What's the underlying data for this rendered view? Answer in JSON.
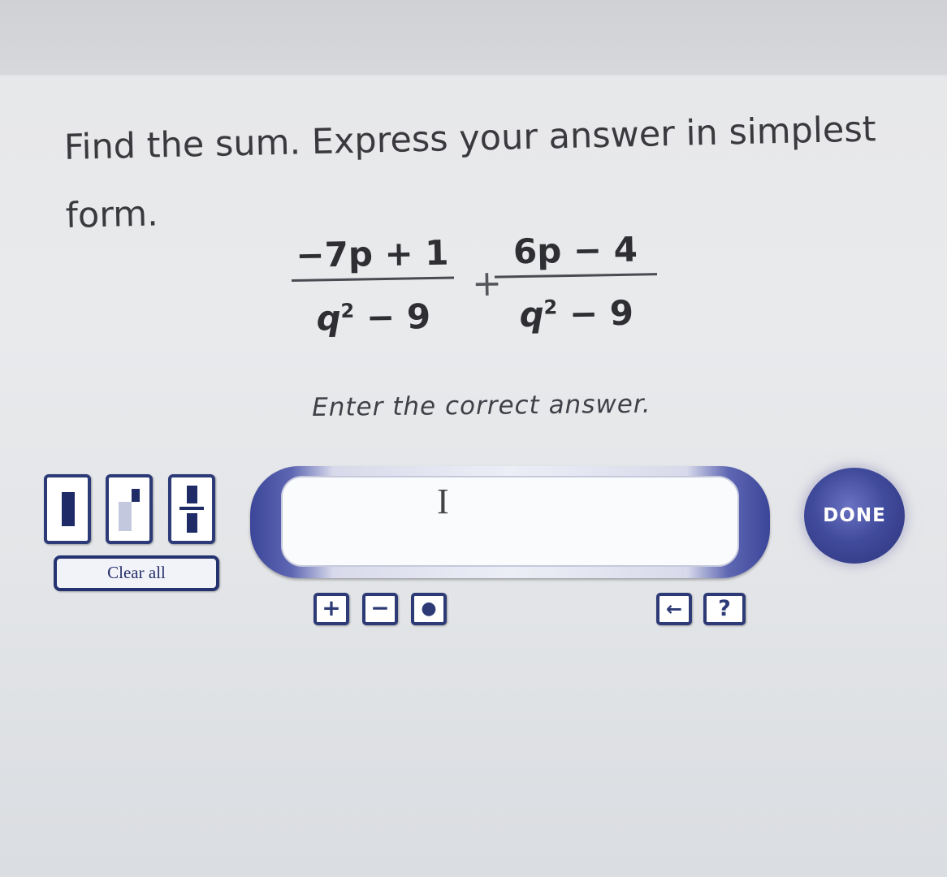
{
  "question": {
    "text": "Find the sum. Express your answer in simplest form."
  },
  "expression": {
    "frac1_num": "−7p + 1",
    "frac1_den_base": "q",
    "frac1_den_exp": "2",
    "frac1_den_rest": " − 9",
    "operator": "+",
    "frac2_num": "6p − 4",
    "frac2_den_base": "q",
    "frac2_den_exp": "2",
    "frac2_den_rest": " − 9"
  },
  "instruction": "Enter the correct answer.",
  "answer": {
    "value": ""
  },
  "templates": [
    "box-template-icon",
    "exponent-template-icon",
    "fraction-template-icon"
  ],
  "clear_label": "Clear all",
  "tools": {
    "plus": "+",
    "minus": "−",
    "dot": "●",
    "back": "←",
    "help": "?"
  },
  "done_label": "DONE",
  "colors": {
    "accent": "#2d3a76",
    "frame": "#3c4699"
  }
}
